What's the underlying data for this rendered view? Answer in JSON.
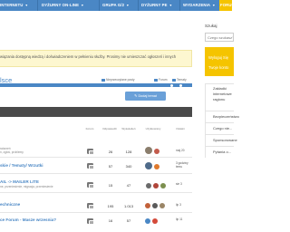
{
  "topnav": {
    "items": [
      {
        "label": "INTERNETU"
      },
      {
        "label": "DYŻURNY ON-LINE"
      },
      {
        "label": "GRUPA G/2"
      },
      {
        "label": "DYŻURNY PE"
      },
      {
        "label": "WYDARZENIA"
      },
      {
        "label": "FORUM"
      }
    ]
  },
  "notice": {
    "text": "wiązania dostępną wiedzą i doświadczeniem w pełnieniu służby. Prosimy nie umieszczać ogłoszeń i innych"
  },
  "forum": {
    "title": "lsce",
    "meta_subscribe": "Nieprzeczytane posty",
    "meta_forum": "Forum",
    "meta_new": "Tematy"
  },
  "new_topic_button": "Dodaj temat",
  "table_head": {
    "forum": "Forum",
    "replies": "Odpowiedzi",
    "posts": "Wyświetleń",
    "users": "Użytkownicy",
    "activity": "Ostatni"
  },
  "rows": [
    {
      "title": "",
      "sub": "ratorzeń",
      "sub2": "n, zgłoś, problemy",
      "replies": "26",
      "views": "128",
      "when": "maj 20"
    },
    {
      "title": "skie / Tematy/ Wrzutki",
      "sub": "",
      "sub2": "",
      "replies": "57",
      "views": "340",
      "when": "3 godziny temu"
    },
    {
      "title": "AIL -> MAILER LITE",
      "sub": "ne, przeniesienie, migracja, przeniesienie",
      "sub2": "",
      "replies": "15",
      "views": "47",
      "when": "sie 3"
    },
    {
      "title": "echniczne",
      "sub": "",
      "sub2": "",
      "replies": "195",
      "views": "1.013",
      "when": "lip 3"
    },
    {
      "title": "ce Forum - Masze wrzesnia?",
      "sub": "",
      "sub2": "",
      "replies": "16",
      "views": "57",
      "when": "lip 11"
    }
  ],
  "sidebar": {
    "search_label": "Szukaj",
    "search_placeholder": "Czego szukasz?",
    "promo_line1": "Wyloguj Się",
    "promo_line2": "Twoje konto",
    "links": [
      "Zakładki internetowe ragionu",
      "Bezpieczeństwo",
      "Czego nie...",
      "Sponsorowane",
      "Pytania o..."
    ]
  },
  "colors": {
    "nav_blue": "#4a87c5",
    "accent_yellow": "#f5c400",
    "notice_bg": "#fdf7d0"
  }
}
